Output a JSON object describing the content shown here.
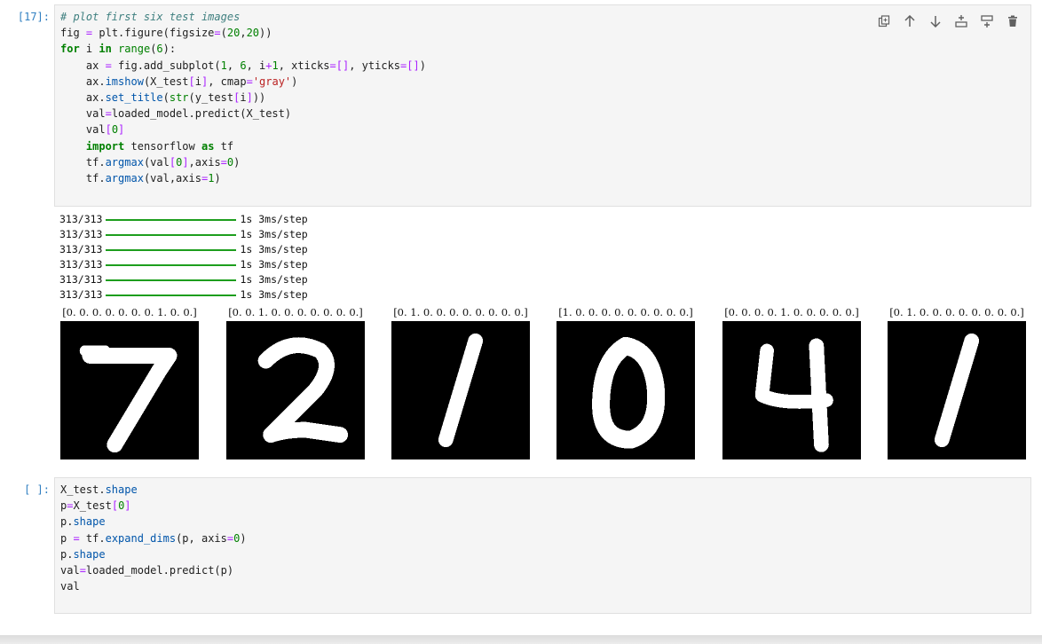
{
  "cell1": {
    "prompt": "[17]:",
    "lines": [
      "# plot first six test images",
      "fig = plt.figure(figsize=(20,20))",
      "for i in range(6):",
      "    ax = fig.add_subplot(1, 6, i+1, xticks=[], yticks=[])",
      "    ax.imshow(X_test[i], cmap='gray')",
      "    ax.set_title(str(y_test[i]))",
      "    val=loaded_model.predict(X_test)",
      "    val[0]",
      "    import tensorflow as tf",
      "    tf.argmax(val[0],axis=0)",
      "    tf.argmax(val,axis=1)"
    ],
    "toolbar": [
      "duplicate-icon",
      "move-up-icon",
      "move-down-icon",
      "insert-above-icon",
      "insert-below-icon",
      "delete-icon"
    ]
  },
  "output": {
    "progress": [
      {
        "count": "313/313",
        "time": "1s",
        "rate": "3ms/step"
      },
      {
        "count": "313/313",
        "time": "1s",
        "rate": "3ms/step"
      },
      {
        "count": "313/313",
        "time": "1s",
        "rate": "3ms/step"
      },
      {
        "count": "313/313",
        "time": "1s",
        "rate": "3ms/step"
      },
      {
        "count": "313/313",
        "time": "1s",
        "rate": "3ms/step"
      },
      {
        "count": "313/313",
        "time": "1s",
        "rate": "3ms/step"
      }
    ],
    "figures": [
      {
        "title": "[0. 0. 0. 0. 0. 0. 0. 1. 0. 0.]",
        "digit": "7"
      },
      {
        "title": "[0. 0. 1. 0. 0. 0. 0. 0. 0. 0.]",
        "digit": "2"
      },
      {
        "title": "[0. 1. 0. 0. 0. 0. 0. 0. 0. 0.]",
        "digit": "1"
      },
      {
        "title": "[1. 0. 0. 0. 0. 0. 0. 0. 0. 0.]",
        "digit": "0"
      },
      {
        "title": "[0. 0. 0. 0. 1. 0. 0. 0. 0. 0.]",
        "digit": "4"
      },
      {
        "title": "[0. 1. 0. 0. 0. 0. 0. 0. 0. 0.]",
        "digit": "1"
      }
    ]
  },
  "cell2": {
    "prompt": "[ ]:",
    "lines": [
      "X_test.shape",
      "p=X_test[0]",
      "p.shape",
      "p = tf.expand_dims(p, axis=0)",
      "p.shape",
      "val=loaded_model.predict(p)",
      "val"
    ]
  }
}
